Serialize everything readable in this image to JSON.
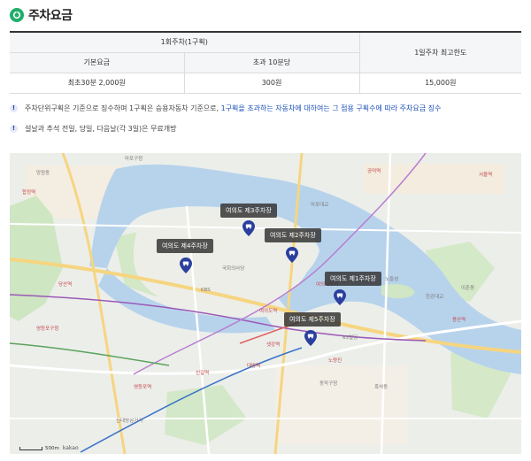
{
  "header": {
    "title": "주차요금"
  },
  "fee_table": {
    "group_header": "1회주차(1구획)",
    "max_header": "1일주차 최고한도",
    "col_basic": "기본요금",
    "col_extra": "초과 10분당",
    "val_basic": "최초30분 2,000원",
    "val_extra": "300원",
    "val_max": "15,000원"
  },
  "notes": {
    "note1_before": "주차단위구획은 기준으로 징수하며 1구획은 승용자동차 기준으로, ",
    "note1_highlight": "1구획을 초과하는 자동차에 대하여는 그 점용 구획수에 따라 주차요금 징수",
    "note2": "설날과 추석 전일, 당일, 다음날(각 3일)은 무료개방"
  },
  "map": {
    "markers": [
      {
        "id": "lot3",
        "label": "여의도 제3주차장"
      },
      {
        "id": "lot4",
        "label": "여의도 제4주차장"
      },
      {
        "id": "lot2",
        "label": "여의도 제2주차장"
      },
      {
        "id": "lot1",
        "label": "여의도 제1주차장"
      },
      {
        "id": "lot5",
        "label": "여의도 제5주차장"
      }
    ],
    "places": {
      "p1": "마포구청",
      "p2": "망원동",
      "p3": "합정역",
      "p4": "당산역",
      "p5": "영등포구청",
      "p6": "KBS",
      "p7": "국회의사당",
      "p8": "여의도역",
      "p9": "여의나루역",
      "p10": "63빌딩",
      "p11": "노량진",
      "p12": "대방역",
      "p13": "신길역",
      "p14": "용산역",
      "p15": "한강대교",
      "p16": "이촌동",
      "p17": "서울역",
      "p18": "공덕역",
      "p19": "마포대교",
      "p20": "샛강역",
      "p21": "영등포역",
      "p22": "신대방삼거리",
      "p23": "흑석동",
      "p24": "동작구청",
      "p25": "노들섬"
    },
    "scale_label": "500m",
    "brand": "kakao"
  }
}
